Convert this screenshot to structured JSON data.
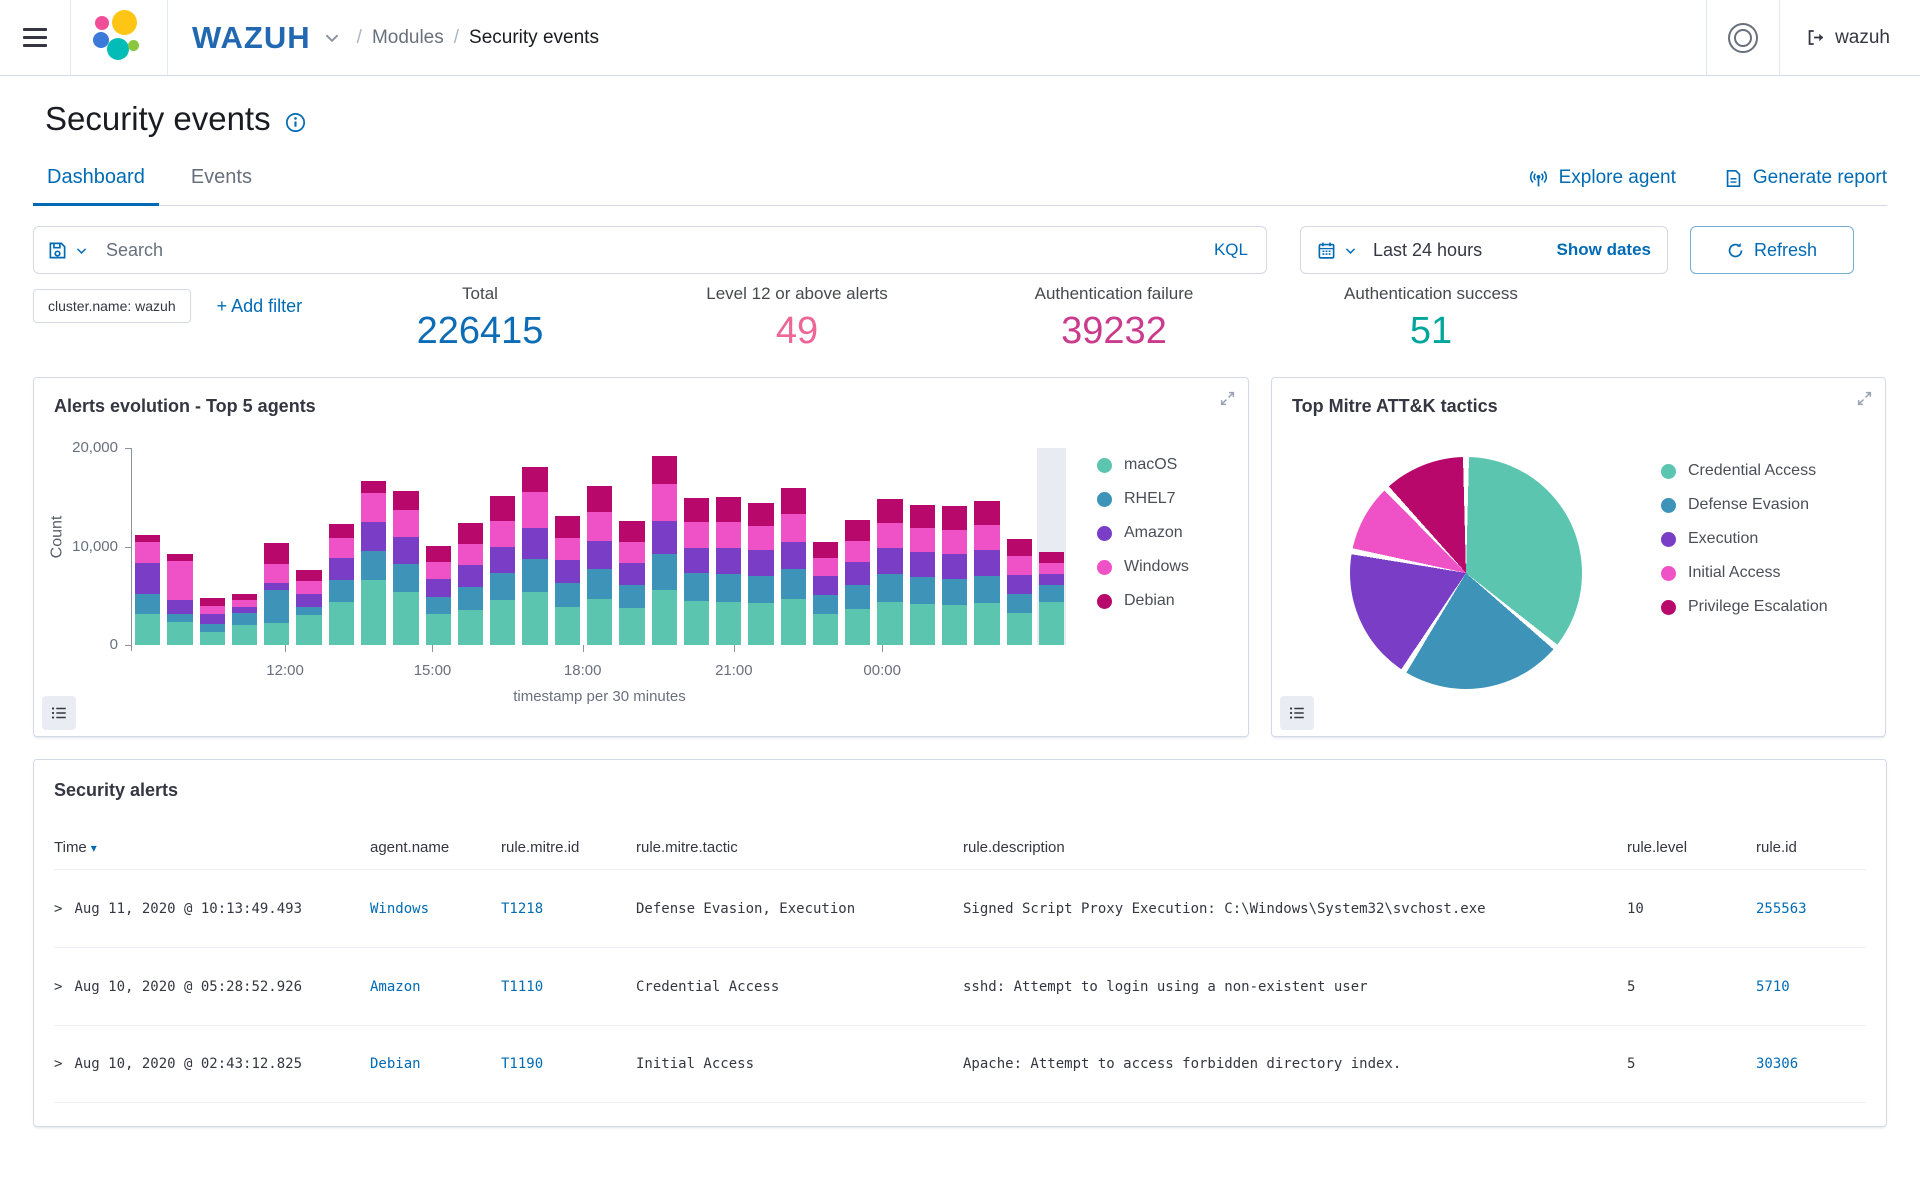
{
  "header": {
    "brand": "WAZUH",
    "breadcrumb_separator": "/",
    "breadcrumb": [
      "Modules",
      "Security events"
    ],
    "username": "wazuh"
  },
  "page": {
    "title": "Security events"
  },
  "tabs": [
    {
      "label": "Dashboard",
      "active": true
    },
    {
      "label": "Events",
      "active": false
    }
  ],
  "toolbar": {
    "explore_agent": "Explore agent",
    "generate_report": "Generate report"
  },
  "query_bar": {
    "search_placeholder": "Search",
    "language": "KQL",
    "time_range": "Last 24 hours",
    "show_dates": "Show dates",
    "refresh": "Refresh"
  },
  "filter_bar": {
    "pill": "cluster.name: wazuh",
    "add_filter": "+ Add filter"
  },
  "stats": [
    {
      "label": "Total",
      "value": "226415",
      "color": "#0C6DB6"
    },
    {
      "label": "Level 12 or above alerts",
      "value": "49",
      "color": "#ED6695"
    },
    {
      "label": "Authentication failure",
      "value": "39232",
      "color": "#CB3B8D"
    },
    {
      "label": "Authentication success",
      "value": "51",
      "color": "#00A69B"
    }
  ],
  "icons": {
    "sort_desc": "▾",
    "row_expand": ">",
    "expand_panel": "⤢"
  },
  "chart_data": [
    {
      "type": "bar",
      "stacked": true,
      "title": "Alerts evolution - Top 5 agents",
      "xlabel": "timestamp per 30 minutes",
      "ylabel": "Count",
      "ylim": [
        0,
        20000
      ],
      "yticks": [
        {
          "label": "0",
          "pct": 100
        },
        {
          "label": "10,000",
          "pct": 50
        },
        {
          "label": "20,000",
          "pct": 0
        }
      ],
      "xticks": [
        {
          "label": "12:00",
          "pct": 16.3
        },
        {
          "label": "15:00",
          "pct": 32.1
        },
        {
          "label": "18:00",
          "pct": 48.2
        },
        {
          "label": "21:00",
          "pct": 64.4
        },
        {
          "label": "00:00",
          "pct": 80.3
        }
      ],
      "legend_position": "right",
      "highlight_last_bar": true,
      "series": [
        {
          "name": "macOS",
          "color": "#5CC5B0",
          "values": [
            3100,
            2300,
            1300,
            2000,
            2200,
            3000,
            4400,
            6600,
            5400,
            3100,
            3600,
            4600,
            5400,
            3900,
            4700,
            3800,
            5600,
            4500,
            4400,
            4300,
            4700,
            3100,
            3700,
            4400,
            4200,
            4100,
            4300,
            3200,
            4400
          ]
        },
        {
          "name": "RHEL7",
          "color": "#3D93B8",
          "values": [
            2100,
            900,
            800,
            1300,
            3400,
            900,
            2200,
            2900,
            2800,
            1800,
            2300,
            2700,
            3300,
            2400,
            3000,
            2300,
            3600,
            2800,
            2800,
            2700,
            3000,
            2000,
            2400,
            2800,
            2700,
            2600,
            2700,
            2000,
            1700
          ]
        },
        {
          "name": "Amazon",
          "color": "#7A3DC6",
          "values": [
            3100,
            1400,
            1100,
            600,
            700,
            1300,
            2200,
            3000,
            2800,
            1800,
            2200,
            2700,
            3200,
            2300,
            2900,
            2200,
            3400,
            2600,
            2700,
            2600,
            2800,
            1900,
            2300,
            2600,
            2500,
            2500,
            2600,
            1900,
            1100
          ]
        },
        {
          "name": "Windows",
          "color": "#EE52C6",
          "values": [
            2200,
            3900,
            800,
            700,
            1900,
            1300,
            2100,
            2900,
            2700,
            1700,
            2200,
            2600,
            3600,
            2300,
            2900,
            2200,
            3700,
            2600,
            2600,
            2500,
            2800,
            1800,
            2200,
            2600,
            2500,
            2500,
            2600,
            1900,
            1100
          ]
        },
        {
          "name": "Debian",
          "color": "#B9086B",
          "values": [
            700,
            700,
            800,
            600,
            2200,
            1100,
            1400,
            1300,
            1900,
            1700,
            2100,
            2500,
            2600,
            2200,
            2600,
            2100,
            2900,
            2400,
            2500,
            2300,
            2600,
            1700,
            2100,
            2400,
            2300,
            2400,
            2400,
            1800,
            1100
          ]
        }
      ]
    },
    {
      "type": "pie",
      "title": "Top Mitre ATT&K tactics",
      "legend_position": "right",
      "slices": [
        {
          "label": "Credential Access",
          "color": "#5CC5B0",
          "value": 36
        },
        {
          "label": "Defense Evasion",
          "color": "#3D93B8",
          "value": 23
        },
        {
          "label": "Execution",
          "color": "#7A3DC6",
          "value": 19
        },
        {
          "label": "Initial Access",
          "color": "#EE52C6",
          "value": 10
        },
        {
          "label": "Privilege Escalation",
          "color": "#B9086B",
          "value": 12
        }
      ]
    }
  ],
  "security_alerts": {
    "title": "Security alerts",
    "columns": [
      "Time",
      "agent.name",
      "rule.mitre.id",
      "rule.mitre.tactic",
      "rule.description",
      "rule.level",
      "rule.id"
    ],
    "rows": [
      {
        "time": "Aug 11, 2020 @ 10:13:49.493",
        "agent": "Windows",
        "mitre_id": "T1218",
        "tactic": "Defense Evasion, Execution",
        "description": "Signed Script Proxy Execution: C:\\Windows\\System32\\svchost.exe",
        "level": "10",
        "rule_id": "255563"
      },
      {
        "time": "Aug 10, 2020 @ 05:28:52.926",
        "agent": "Amazon",
        "mitre_id": "T1110",
        "tactic": "Credential Access",
        "description": "sshd: Attempt to login using a non-existent user",
        "level": "5",
        "rule_id": "5710"
      },
      {
        "time": "Aug 10, 2020 @ 02:43:12.825",
        "agent": "Debian",
        "mitre_id": "T1190",
        "tactic": "Initial Access",
        "description": "Apache: Attempt to access forbidden directory index.",
        "level": "5",
        "rule_id": "30306"
      }
    ]
  }
}
